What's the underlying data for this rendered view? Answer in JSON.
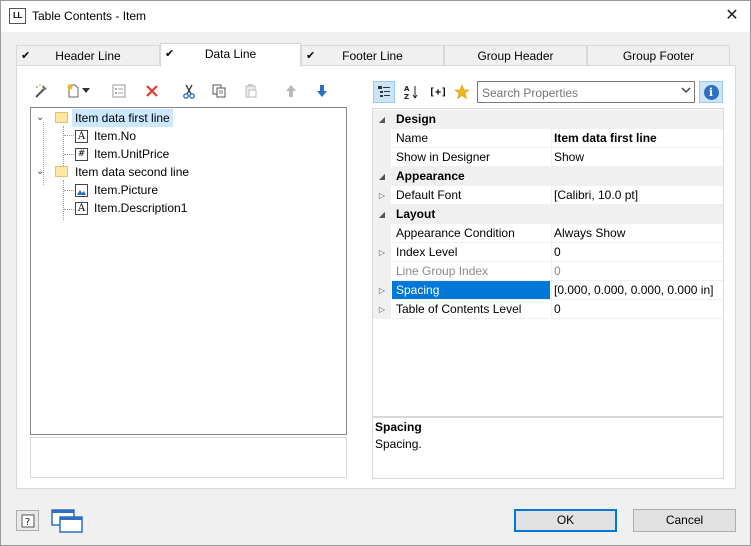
{
  "window": {
    "app_icon_text": "LL",
    "title": "Table Contents - Item",
    "close_glyph": "✕"
  },
  "tabs": [
    {
      "label": "Header Line",
      "checked": true,
      "active": false
    },
    {
      "label": "Data Line",
      "checked": true,
      "active": true
    },
    {
      "label": "Footer Line",
      "checked": true,
      "active": false
    },
    {
      "label": "Group Header",
      "checked": false,
      "active": false
    },
    {
      "label": "Group Footer",
      "checked": false,
      "active": false
    }
  ],
  "check_glyph": "✔",
  "left_toolbar": {
    "icons": [
      "wizard-icon",
      "new-item-icon",
      "dropdown-arrow-icon",
      "properties-icon",
      "delete-icon",
      "cut-icon",
      "copy-icon",
      "paste-icon",
      "move-up-icon",
      "move-down-icon"
    ]
  },
  "tree": {
    "items": [
      {
        "label": "Item data first line",
        "kind": "folder",
        "level": 0,
        "expanded": true,
        "selected": true
      },
      {
        "label": "Item.No",
        "kind": "text",
        "level": 1
      },
      {
        "label": "Item.UnitPrice",
        "kind": "number",
        "level": 1
      },
      {
        "label": "Item data second line",
        "kind": "folder",
        "level": 0,
        "expanded": true
      },
      {
        "label": "Item.Picture",
        "kind": "picture",
        "level": 1
      },
      {
        "label": "Item.Description1",
        "kind": "text",
        "level": 1
      }
    ]
  },
  "prop_toolbar": {
    "search_placeholder": "Search Properties",
    "icons": [
      "categorized-icon",
      "sort-alpha-icon",
      "formula-toggle-icon",
      "favorites-star-icon",
      "info-icon"
    ],
    "formula_label": "[+]",
    "info_label": "i"
  },
  "properties": [
    {
      "type": "category",
      "name": "Design"
    },
    {
      "type": "prop",
      "name": "Name",
      "value": "Item data first line",
      "bold": true
    },
    {
      "type": "prop",
      "name": "Show in Designer",
      "value": "Show"
    },
    {
      "type": "category",
      "name": "Appearance"
    },
    {
      "type": "prop",
      "name": "Default Font",
      "value": "[Calibri, 10.0 pt]",
      "expandable": true
    },
    {
      "type": "category",
      "name": "Layout"
    },
    {
      "type": "prop",
      "name": "Appearance Condition",
      "value": "Always Show"
    },
    {
      "type": "prop",
      "name": "Index Level",
      "value": "0",
      "expandable": true
    },
    {
      "type": "prop",
      "name": "Line Group Index",
      "value": "0",
      "disabled": true
    },
    {
      "type": "prop",
      "name": "Spacing",
      "value": "[0.000, 0.000, 0.000, 0.000 in]",
      "expandable": true,
      "selected": true
    },
    {
      "type": "prop",
      "name": "Table of Contents Level",
      "value": "0",
      "expandable": true
    }
  ],
  "description": {
    "title": "Spacing",
    "text": "Spacing."
  },
  "footer": {
    "ok_label": "OK",
    "cancel_label": "Cancel"
  },
  "colors": {
    "selection": "#0078d7",
    "tree_selection": "#cce8ff",
    "delete_red": "#e03a2f",
    "arrow_blue": "#2f6fbf"
  }
}
